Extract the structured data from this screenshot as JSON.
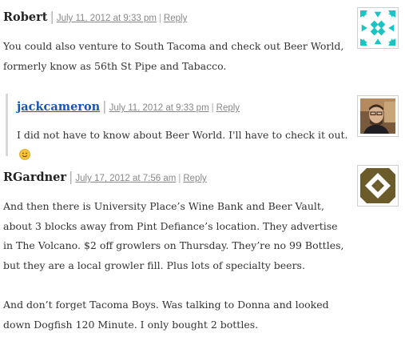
{
  "comments": [
    {
      "author": "Robert",
      "date": "July 11, 2012 at 9:33 pm",
      "reply_label": "Reply",
      "text": [
        "You could also venture to South Tacoma and check out Beer World, formerly know as 56th St Pipe and Tabacco."
      ],
      "avatar_icon": "identicon-teal-icon",
      "avatar_color": "#19c4c4"
    },
    {
      "author": "jackcameron",
      "date": "July 11, 2012 at 9:33 pm",
      "reply_label": "Reply",
      "text": [
        "I did not have to know about Beer World. I'll have to check it out."
      ],
      "avatar_icon": "user-photo-icon",
      "emoji": "smiley-icon"
    },
    {
      "author": "RGardner",
      "date": "July 17, 2012 at 7:56 am",
      "reply_label": "Reply",
      "text": [
        "And then there is University Place’s Wine Bank and Beer Vault, about 3 blocks away from Pint Defiance’s location. They advertise in The Volcano. $2 off growlers on Thursday. They’re no 99 Bottles, but they are a local growler fill. Plus lots of specialty beers.",
        "And don’t forget Tacoma Boys. Was talking to Donna and looked down Dogfish 120 Minute. I only bought 2 bottles."
      ],
      "avatar_icon": "identicon-olive-icon",
      "avatar_color": "#6b5a2a"
    }
  ]
}
